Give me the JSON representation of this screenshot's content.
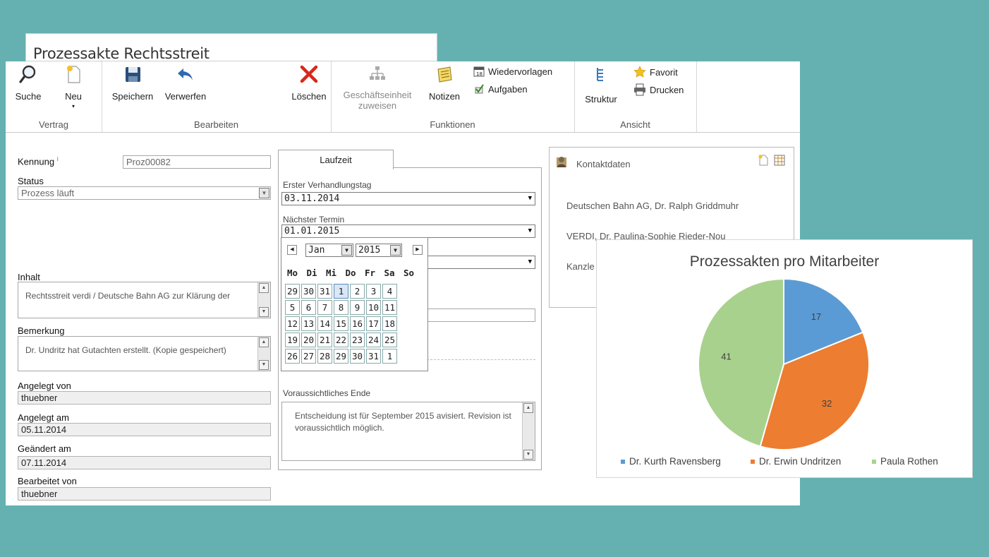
{
  "window_title": "Prozessakte Rechtsstreit",
  "ribbon": {
    "vertrag": {
      "label": "Vertrag",
      "suche": "Suche",
      "neu": "Neu"
    },
    "bearbeiten": {
      "label": "Bearbeiten",
      "speichern": "Speichern",
      "verwerfen": "Verwerfen",
      "loeschen": "Löschen"
    },
    "funktionen": {
      "label": "Funktionen",
      "geschaeftseinheit_1": "Geschäftseinheit",
      "geschaeftseinheit_2": "zuweisen",
      "notizen": "Notizen",
      "wiedervorlagen": "Wiedervorlagen",
      "aufgaben": "Aufgaben"
    },
    "ansicht": {
      "label": "Ansicht",
      "struktur": "Struktur",
      "favorit": "Favorit",
      "drucken": "Drucken"
    }
  },
  "form": {
    "kennung_label": "Kennung",
    "kennung_info": "i",
    "kennung_value": "Proz00082",
    "status_label": "Status",
    "status_value": "Prozess läuft",
    "inhalt_label": "Inhalt",
    "inhalt_value": "Rechtsstreit verdi / Deutsche Bahn AG zur Klärung der",
    "bemerkung_label": "Bemerkung",
    "bemerkung_value": "Dr. Undritz hat Gutachten erstellt. (Kopie gespeichert)",
    "angelegt_von_label": "Angelegt von",
    "angelegt_von_value": "thuebner",
    "angelegt_am_label": "Angelegt am",
    "angelegt_am_value": "05.11.2014",
    "geaendert_am_label": "Geändert am",
    "geaendert_am_value": "07.11.2014",
    "bearbeitet_von_label": "Bearbeitet von",
    "bearbeitet_von_value": "thuebner"
  },
  "laufzeit": {
    "tab_label": "Laufzeit",
    "erster_label": "Erster Verhandlungstag",
    "erster_value": "03.11.2014",
    "naechster_label": "Nächster Termin",
    "naechster_value": "01.01.2015",
    "ende_label": "Voraussichtliches Ende",
    "ende_value": "Entscheidung ist für September 2015 avisiert. Revision ist voraussichtlich möglich."
  },
  "calendar": {
    "month": "Jan",
    "year": "2015",
    "prev": "◀",
    "next": "▶",
    "weekdays": [
      "Mo",
      "Di",
      "Mi",
      "Do",
      "Fr",
      "Sa",
      "So"
    ],
    "weeks": [
      [
        "29",
        "30",
        "31",
        "1",
        "2",
        "3",
        "4"
      ],
      [
        "5",
        "6",
        "7",
        "8",
        "9",
        "10",
        "11"
      ],
      [
        "12",
        "13",
        "14",
        "15",
        "16",
        "17",
        "18"
      ],
      [
        "19",
        "20",
        "21",
        "22",
        "23",
        "24",
        "25"
      ],
      [
        "26",
        "27",
        "28",
        "29",
        "30",
        "31",
        "1"
      ]
    ],
    "selected": "1"
  },
  "contact": {
    "title": "Kontaktdaten",
    "entries": [
      "Deutschen Bahn AG, Dr. Ralph Griddmuhr",
      "VERDI, Dr. Paulina-Sophie Rieder-Nou",
      "Kanzle"
    ]
  },
  "chart_data": {
    "type": "pie",
    "title": "Prozessakten pro Mitarbeiter",
    "categories": [
      "Dr. Kurth Ravensberg",
      "Dr. Erwin Undritzen",
      "Paula Rothen"
    ],
    "values": [
      17,
      32,
      41
    ],
    "colors": [
      "#5b9bd5",
      "#ed7d31",
      "#a9d18e"
    ],
    "legend_position": "bottom"
  }
}
